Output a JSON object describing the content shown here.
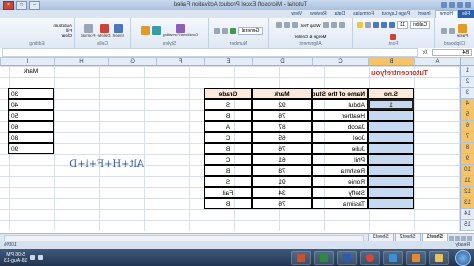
{
  "window": {
    "title": "Tutorial - Microsoft Excel Product Activation Failed"
  },
  "ribbon_tabs": [
    "File",
    "Home",
    "Insert",
    "Page Layout",
    "Formulas",
    "Data",
    "Review",
    "View"
  ],
  "ribbon_groups": {
    "clipboard": {
      "label": "Clipboard",
      "paste": "Paste"
    },
    "font": {
      "label": "Font",
      "font_name": "Calibri",
      "font_size": "11"
    },
    "alignment": {
      "label": "Alignment",
      "wrap": "Wrap Text",
      "merge": "Merge & Center"
    },
    "number": {
      "label": "Number",
      "format": "General"
    },
    "styles": {
      "label": "Styles",
      "conditional": "Conditional Formatting",
      "table": "Format as Table",
      "cell": "Cell Styles"
    },
    "cells": {
      "label": "Cells",
      "insert": "Insert",
      "delete": "Delete",
      "format": "Format"
    },
    "editing": {
      "label": "Editing",
      "autosum": "AutoSum",
      "fill": "Fill",
      "clear": "Clear",
      "sort": "Sort & Filter",
      "find": "Find & Select"
    }
  },
  "formula_bar": {
    "name_box": "B4",
    "fx": "fx",
    "value": ""
  },
  "columns": [
    "A",
    "B",
    "C",
    "D",
    "E",
    "F",
    "G",
    "H",
    "I"
  ],
  "rows": [
    "1",
    "2",
    "3",
    "4",
    "5",
    "6",
    "7",
    "8",
    "9",
    "10",
    "11",
    "12",
    "13",
    "14",
    "15"
  ],
  "sheet": {
    "site_title": "Tutorcentrefyou",
    "table_headers": {
      "sno": "S.no",
      "name": "Name of the Student",
      "mark": "Mark",
      "grade": "Grade"
    },
    "students": [
      {
        "sno": "1",
        "name": "Abdul",
        "mark": "92",
        "grade": "S"
      },
      {
        "sno": "",
        "name": "Heather",
        "mark": "76",
        "grade": "B"
      },
      {
        "sno": "",
        "name": "Jacob",
        "mark": "87",
        "grade": "A"
      },
      {
        "sno": "",
        "name": "Joel",
        "mark": "65",
        "grade": "C"
      },
      {
        "sno": "",
        "name": "Julie",
        "mark": "76",
        "grade": "B"
      },
      {
        "sno": "",
        "name": "Phil",
        "mark": "61",
        "grade": "C"
      },
      {
        "sno": "",
        "name": "Reshma",
        "mark": "78",
        "grade": "B"
      },
      {
        "sno": "",
        "name": "Ronie",
        "mark": "91",
        "grade": "S"
      },
      {
        "sno": "",
        "name": "Steffy",
        "mark": "34",
        "grade": "Fail"
      },
      {
        "sno": "",
        "name": "Tasiima",
        "mark": "76",
        "grade": "B"
      }
    ],
    "mark_ref_header": "Mark",
    "mark_ref": [
      "30",
      "40",
      "50",
      "60",
      "80",
      "90"
    ],
    "shortcut_note": "Alt+H+F+i+D"
  },
  "sheet_tabs": [
    "Sheet1",
    "Sheet2",
    "Sheet3"
  ],
  "status": {
    "left": "Ready",
    "zoom": "100%"
  },
  "taskbar": {
    "time": "5:06 PM",
    "date": "18-Aug-13"
  }
}
